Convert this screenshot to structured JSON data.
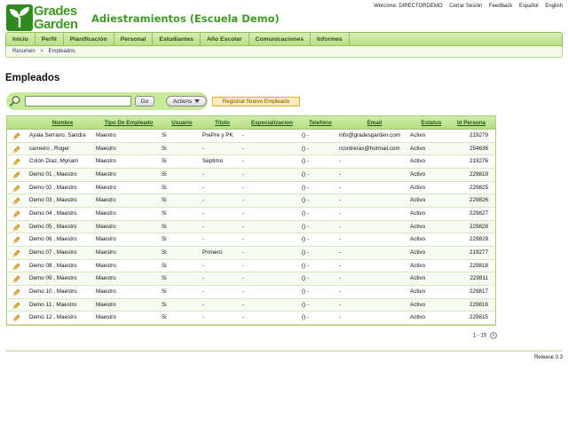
{
  "logo": {
    "line1": "Grades",
    "line2": "Garden"
  },
  "school_name": "Adiestramientos (Escuela Demo)",
  "top_links": {
    "welcome": "Welcome: DIRECTORDEMO",
    "logout": "Cerrar Sesión",
    "feedback": "Feedback",
    "spanish": "Español",
    "english": "English"
  },
  "nav": [
    "Inicio",
    "Perfil",
    "Planificación",
    "Personal",
    "Estudiantes",
    "Año Escolar",
    "Comunicaciones",
    "Informes"
  ],
  "breadcrumb": {
    "first": "Resumen",
    "separator": ">",
    "current": "Empleados"
  },
  "page_title": "Empleados",
  "toolbar": {
    "search_value": "",
    "go_label": "Go",
    "actions_label": "Actions",
    "register_label": "Registrar Nuevo Empleado"
  },
  "table": {
    "headers": [
      "Nombre",
      "Tipo De Empleado",
      "Usuario",
      "Titulo",
      "Especializacion",
      "Telefono",
      "Email",
      "Estatus",
      "Id Persona"
    ],
    "rows": [
      [
        "Ayala Serrano, Sandra",
        "Maestro",
        "Si",
        "PrePre y PK",
        "-",
        "() -",
        "info@gradesgarden.com",
        "Activo",
        "219279"
      ],
      [
        "carneiro , Roger",
        "Maestro",
        "Si",
        "-",
        "-",
        "() -",
        "rcontreras@hotmail.com",
        "Activo",
        "254636"
      ],
      [
        "Colón Díaz, Myriam",
        "Maestro",
        "Si",
        "Septimo",
        "-",
        "() -",
        "-",
        "Activo",
        "219276"
      ],
      [
        "Demo 01 , Maestro",
        "Maestro",
        "Si",
        "-",
        "-",
        "() -",
        "-",
        "Activo",
        "229819"
      ],
      [
        "Demo 02 , Maestro",
        "Maestro",
        "Si",
        "-",
        "-",
        "() -",
        "-",
        "Activo",
        "229825"
      ],
      [
        "Demo 03 , Maestro",
        "Maestro",
        "Si",
        "-",
        "-",
        "() -",
        "-",
        "Activo",
        "229826"
      ],
      [
        "Demo 04 , Maestro",
        "Maestro",
        "Si",
        "-",
        "-",
        "() -",
        "-",
        "Activo",
        "229827"
      ],
      [
        "Demo 05 , Maestro",
        "Maestro",
        "Si",
        "-",
        "-",
        "() -",
        "-",
        "Activo",
        "229828"
      ],
      [
        "Demo 06 , Maestro",
        "Maestro",
        "Si",
        "-",
        "-",
        "() -",
        "-",
        "Activo",
        "229829"
      ],
      [
        "Demo 07 , Maestro",
        "Maestro",
        "Si",
        "Primero",
        "-",
        "() -",
        "-",
        "Activo",
        "219277"
      ],
      [
        "Demo 08 , Maestro",
        "Maestro",
        "Si",
        "-",
        "-",
        "() -",
        "-",
        "Activo",
        "229818"
      ],
      [
        "Demo 09 , Maestro",
        "Maestro",
        "Si",
        "-",
        "-",
        "() -",
        "-",
        "Activo",
        "229811"
      ],
      [
        "Demo 10 , Maestro",
        "Maestro",
        "Si",
        "-",
        "-",
        "() -",
        "-",
        "Activo",
        "229817"
      ],
      [
        "Demo 11 , Maestro",
        "Maestro",
        "Si",
        "-",
        "-",
        "() -",
        "-",
        "Activo",
        "229816"
      ],
      [
        "Demo 12 , Maestro",
        "Maestro",
        "Si",
        "-",
        "-",
        "() -",
        "-",
        "Activo",
        "229815"
      ]
    ]
  },
  "pager": {
    "range": "1 - 15",
    "next_symbol": "›"
  },
  "release": "Release 3.3",
  "colors": {
    "brand_green": "#3f9a22",
    "nav_bg": "#c8e89a",
    "register_bg": "#fdebc2",
    "pencil": "#e5a823"
  },
  "icons": {
    "edit": "pencil-icon",
    "search": "search-icon",
    "dropdown": "chevron-down-icon",
    "next": "chevron-right-icon"
  }
}
